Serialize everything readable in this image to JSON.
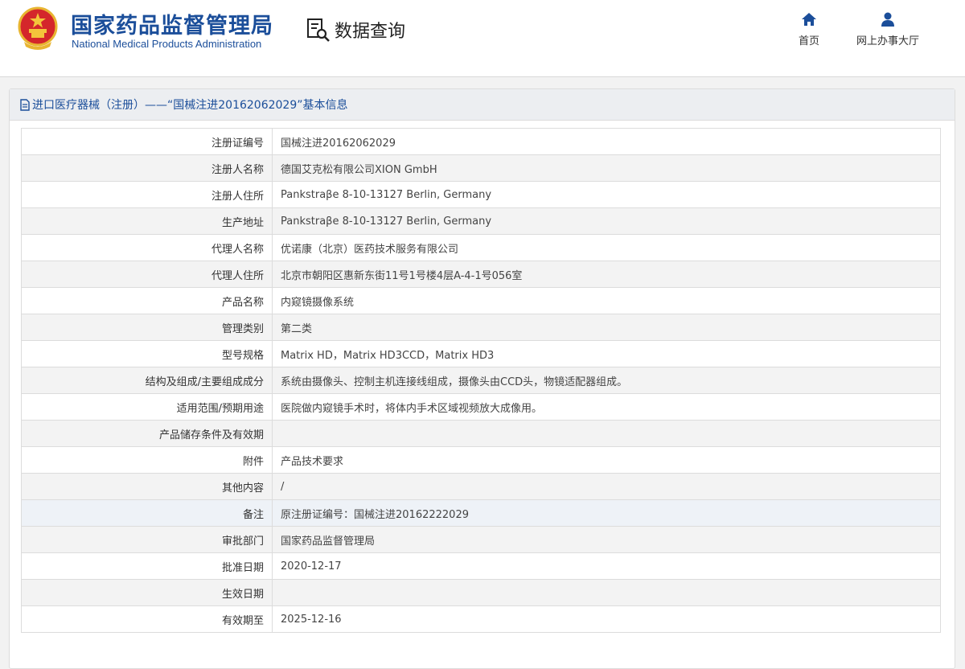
{
  "header": {
    "title_cn": "国家药品监督管理局",
    "title_en": "National Medical Products Administration",
    "query_label": "数据查询",
    "nav": [
      {
        "label": "首页",
        "icon": "home-icon"
      },
      {
        "label": "网上办事大厅",
        "icon": "user-icon"
      }
    ]
  },
  "panel": {
    "title": "进口医疗器械（注册）——“国械注进20162062029”基本信息",
    "rows": [
      {
        "key": "注册证编号",
        "value": "国械注进20162062029"
      },
      {
        "key": "注册人名称",
        "value": "德国艾克松有限公司XION GmbH"
      },
      {
        "key": "注册人住所",
        "value": "Pankstraβe 8-10-13127 Berlin, Germany"
      },
      {
        "key": "生产地址",
        "value": "Pankstraβe 8-10-13127 Berlin, Germany"
      },
      {
        "key": "代理人名称",
        "value": "优诺康（北京）医药技术服务有限公司"
      },
      {
        "key": "代理人住所",
        "value": "北京市朝阳区惠新东街11号1号楼4层A-4-1号056室"
      },
      {
        "key": "产品名称",
        "value": "内窥镜摄像系统"
      },
      {
        "key": "管理类别",
        "value": "第二类"
      },
      {
        "key": "型号规格",
        "value": "Matrix HD，Matrix HD3CCD，Matrix HD3"
      },
      {
        "key": "结构及组成/主要组成成分",
        "value": "系统由摄像头、控制主机连接线组成，摄像头由CCD头，物镜适配器组成。"
      },
      {
        "key": "适用范围/预期用途",
        "value": "医院做内窥镜手术时，将体内手术区域视频放大成像用。"
      },
      {
        "key": "产品储存条件及有效期",
        "value": ""
      },
      {
        "key": "附件",
        "value": "产品技术要求"
      },
      {
        "key": "其他内容",
        "value": "/"
      },
      {
        "key": "备注",
        "value": "原注册证编号：国械注进20162222029"
      },
      {
        "key": "审批部门",
        "value": "国家药品监督管理局"
      },
      {
        "key": "批准日期",
        "value": "2020-12-17"
      },
      {
        "key": "生效日期",
        "value": ""
      },
      {
        "key": "有效期至",
        "value": "2025-12-16"
      }
    ]
  }
}
